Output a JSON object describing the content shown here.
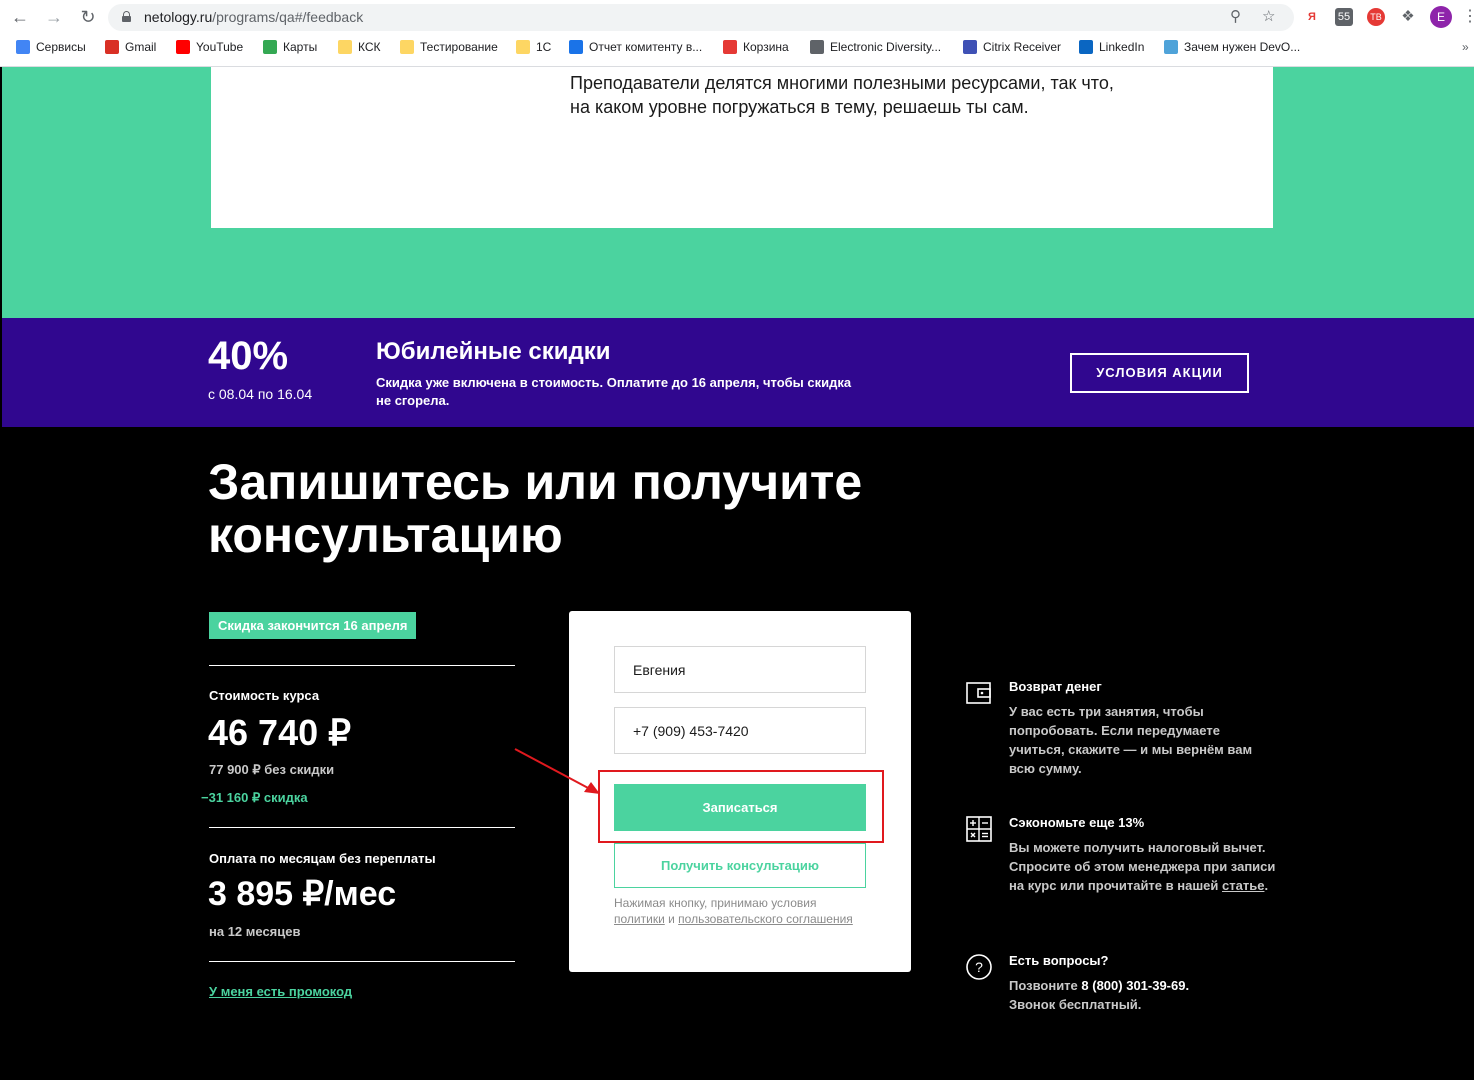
{
  "browser": {
    "url_host": "netology.ru",
    "url_path": "/programs/qa#/feedback",
    "profile_initial": "E",
    "ext_yandex": "Я",
    "ext_1": "55",
    "ext_2": "ТВ",
    "bookmarks": [
      {
        "label": "Сервисы",
        "color": "#4285f4"
      },
      {
        "label": "Gmail",
        "color": "#d93025"
      },
      {
        "label": "YouTube",
        "color": "#ff0000"
      },
      {
        "label": "Карты",
        "color": "#34a853"
      },
      {
        "label": "КСК",
        "color": "#fdd663"
      },
      {
        "label": "Тестирование",
        "color": "#fdd663"
      },
      {
        "label": "1С",
        "color": "#fdd663"
      },
      {
        "label": "Отчет комитенту в...",
        "color": "#1a73e8"
      },
      {
        "label": "Корзина",
        "color": "#e53935"
      },
      {
        "label": "Electronic Diversity...",
        "color": "#5f6368"
      },
      {
        "label": "Citrix Receiver",
        "color": "#3f51b5"
      },
      {
        "label": "LinkedIn",
        "color": "#0a66c2"
      },
      {
        "label": "Зачем нужен DevO...",
        "color": "#4fa3d9"
      }
    ],
    "more": "»"
  },
  "card": {
    "text": "Преподаватели делятся многими полезными ресурсами, так что, на каком уровне погружаться в тему, решаешь ты сам."
  },
  "promo": {
    "percent": "40%",
    "dates": "с 08.04 по 16.04",
    "title": "Юбилейные скидки",
    "description": "Скидка уже включена в стоимость. Оплатите до 16 апреля, чтобы скидка не сгорела.",
    "button": "УСЛОВИЯ АКЦИИ"
  },
  "signup": {
    "headline": "Запишитесь или получите консультацию",
    "badge": "Скидка закончится 16 апреля",
    "cost_label": "Стоимость курса",
    "cost": "46 740 ₽",
    "cost_original": "77 900 ₽ без скидки",
    "cost_discount": "−31 160 ₽ скидка",
    "monthly_label": "Оплата по месяцам без переплаты",
    "monthly": "3 895 ₽/мес",
    "monthly_term": "на 12 месяцев",
    "promo_code": "У меня есть промокод"
  },
  "form": {
    "name_value": "Евгения",
    "phone_value": "+7 (909) 453-7420",
    "submit": "Записаться",
    "consult": "Получить консультацию",
    "terms_prefix": "Нажимая кнопку, принимаю условия",
    "terms_policy": "политики",
    "terms_and": "и",
    "terms_agreement": "пользовательского соглашения"
  },
  "info": [
    {
      "icon": "wallet-icon",
      "title": "Возврат денег",
      "text": "У вас есть три занятия, чтобы попробовать. Если передумаете учиться, скажите — и мы вернём вам всю сумму."
    },
    {
      "icon": "calculator-icon",
      "title": "Сэкономьте еще 13%",
      "text": "Вы можете получить налоговый вычет. Спросите об этом менеджера при записи на курс или прочитайте в нашей",
      "link": "статье",
      "suffix": "."
    },
    {
      "icon": "question-icon",
      "title": "Есть вопросы?",
      "prefix": "Позвоните",
      "phone": "8 (800) 301-39-69.",
      "text": "Звонок бесплатный."
    }
  ],
  "colors": {
    "accent_green": "#4bd39f",
    "promo_purple": "#30078f",
    "annotation_red": "#e0191e"
  }
}
